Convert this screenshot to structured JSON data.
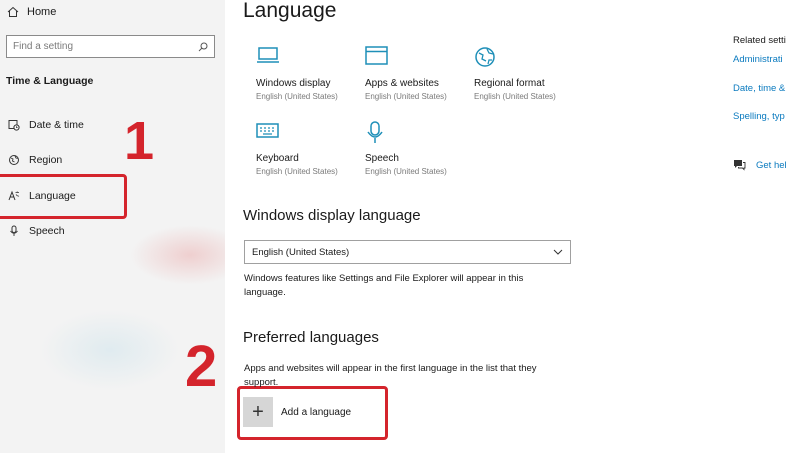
{
  "sidebar": {
    "home_label": "Home",
    "search_placeholder": "Find a setting",
    "section_title": "Time & Language",
    "items": [
      {
        "label": "Date & time",
        "icon": "calendar-clock-icon"
      },
      {
        "label": "Region",
        "icon": "globe-icon"
      },
      {
        "label": "Language",
        "icon": "language-icon"
      },
      {
        "label": "Speech",
        "icon": "microphone-icon"
      }
    ]
  },
  "annotations": {
    "step1": "1",
    "step2": "2",
    "highlight_color": "#d4242c"
  },
  "main": {
    "title": "Language",
    "tiles": [
      {
        "name": "Windows display",
        "sub": "English (United States)",
        "icon": "monitor-icon"
      },
      {
        "name": "Apps & websites",
        "sub": "English (United States)",
        "icon": "browser-window-icon"
      },
      {
        "name": "Regional format",
        "sub": "English (United States)",
        "icon": "globe-icon"
      },
      {
        "name": "Keyboard",
        "sub": "English (United States)",
        "icon": "keyboard-icon"
      },
      {
        "name": "Speech",
        "sub": "English (United States)",
        "icon": "microphone-icon"
      }
    ],
    "display_language": {
      "heading": "Windows display language",
      "selected": "English (United States)",
      "description_line1": "Windows features like Settings and File Explorer will appear in this",
      "description_line2": "language."
    },
    "preferred": {
      "heading": "Preferred languages",
      "description_line1": "Apps and websites will appear in the first language in the list that they",
      "description_line2": "support.",
      "add_label": "Add a language"
    }
  },
  "related": {
    "title": "Related setti",
    "links": [
      "Administrati",
      "Date, time &",
      "Spelling, typ"
    ],
    "help": "Get hel"
  },
  "colors": {
    "accent": "#0a7abf",
    "icon_teal": "#1e8fb8"
  }
}
